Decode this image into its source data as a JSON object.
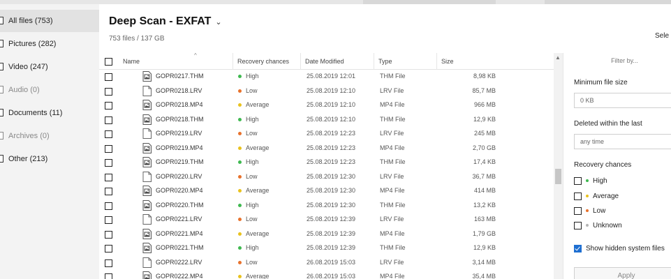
{
  "colors": {
    "high": "#3fb950",
    "low": "#e8722c",
    "average": "#e9c21e",
    "unknown": "#b5b5b5",
    "accent": "#1f6fd1"
  },
  "sidebar": {
    "items": [
      {
        "label": "All files (753)",
        "active": true,
        "dim": false
      },
      {
        "label": "Pictures (282)",
        "active": false,
        "dim": false
      },
      {
        "label": "Video (247)",
        "active": false,
        "dim": false
      },
      {
        "label": "Audio (0)",
        "active": false,
        "dim": true
      },
      {
        "label": "Documents (11)",
        "active": false,
        "dim": false
      },
      {
        "label": "Archives (0)",
        "active": false,
        "dim": true
      },
      {
        "label": "Other (213)",
        "active": false,
        "dim": false
      }
    ]
  },
  "header": {
    "title": "Deep Scan - EXFAT",
    "chevron": "⌄",
    "subtitle": "753 files / 137 GB",
    "select_label": "Sele"
  },
  "table": {
    "columns": [
      "Name",
      "Recovery chances",
      "Date Modified",
      "Type",
      "Size"
    ],
    "sort_caret": "^",
    "rows": [
      {
        "icon": "image-file-icon",
        "name": "GOPR0217.THM",
        "chance": "High",
        "level": "high",
        "date": "25.08.2019 12:01",
        "type": "THM File",
        "size": "8,98 KB"
      },
      {
        "icon": "blank-file-icon",
        "name": "GOPR0218.LRV",
        "chance": "Low",
        "level": "low",
        "date": "25.08.2019 12:10",
        "type": "LRV File",
        "size": "85,7 MB"
      },
      {
        "icon": "image-file-icon",
        "name": "GOPR0218.MP4",
        "chance": "Average",
        "level": "average",
        "date": "25.08.2019 12:10",
        "type": "MP4 File",
        "size": "966 MB"
      },
      {
        "icon": "image-file-icon",
        "name": "GOPR0218.THM",
        "chance": "High",
        "level": "high",
        "date": "25.08.2019 12:10",
        "type": "THM File",
        "size": "12,9 KB"
      },
      {
        "icon": "blank-file-icon",
        "name": "GOPR0219.LRV",
        "chance": "Low",
        "level": "low",
        "date": "25.08.2019 12:23",
        "type": "LRV File",
        "size": "245 MB"
      },
      {
        "icon": "image-file-icon",
        "name": "GOPR0219.MP4",
        "chance": "Average",
        "level": "average",
        "date": "25.08.2019 12:23",
        "type": "MP4 File",
        "size": "2,70 GB"
      },
      {
        "icon": "image-file-icon",
        "name": "GOPR0219.THM",
        "chance": "High",
        "level": "high",
        "date": "25.08.2019 12:23",
        "type": "THM File",
        "size": "17,4 KB"
      },
      {
        "icon": "blank-file-icon",
        "name": "GOPR0220.LRV",
        "chance": "Low",
        "level": "low",
        "date": "25.08.2019 12:30",
        "type": "LRV File",
        "size": "36,7 MB"
      },
      {
        "icon": "image-file-icon",
        "name": "GOPR0220.MP4",
        "chance": "Average",
        "level": "average",
        "date": "25.08.2019 12:30",
        "type": "MP4 File",
        "size": "414 MB"
      },
      {
        "icon": "image-file-icon",
        "name": "GOPR0220.THM",
        "chance": "High",
        "level": "high",
        "date": "25.08.2019 12:30",
        "type": "THM File",
        "size": "13,2 KB"
      },
      {
        "icon": "blank-file-icon",
        "name": "GOPR0221.LRV",
        "chance": "Low",
        "level": "low",
        "date": "25.08.2019 12:39",
        "type": "LRV File",
        "size": "163 MB"
      },
      {
        "icon": "image-file-icon",
        "name": "GOPR0221.MP4",
        "chance": "Average",
        "level": "average",
        "date": "25.08.2019 12:39",
        "type": "MP4 File",
        "size": "1,79 GB"
      },
      {
        "icon": "image-file-icon",
        "name": "GOPR0221.THM",
        "chance": "High",
        "level": "high",
        "date": "25.08.2019 12:39",
        "type": "THM File",
        "size": "12,9 KB"
      },
      {
        "icon": "blank-file-icon",
        "name": "GOPR0222.LRV",
        "chance": "Low",
        "level": "low",
        "date": "26.08.2019 15:03",
        "type": "LRV File",
        "size": "3,14 MB"
      },
      {
        "icon": "image-file-icon",
        "name": "GOPR0222.MP4",
        "chance": "Average",
        "level": "average",
        "date": "26.08.2019 15:03",
        "type": "MP4 File",
        "size": "35,4 MB"
      }
    ]
  },
  "filter": {
    "title": "Filter by...",
    "min_size_label": "Minimum file size",
    "min_size_value": "0 KB",
    "deleted_label": "Deleted within the last",
    "deleted_value": "any time",
    "chances_label": "Recovery chances",
    "chances": [
      {
        "label": "High",
        "level": "high"
      },
      {
        "label": "Average",
        "level": "average"
      },
      {
        "label": "Low",
        "level": "low"
      },
      {
        "label": "Unknown",
        "level": "unknown"
      }
    ],
    "hidden_label": "Show hidden system files",
    "hidden_checked": true,
    "apply_label": "Apply"
  }
}
